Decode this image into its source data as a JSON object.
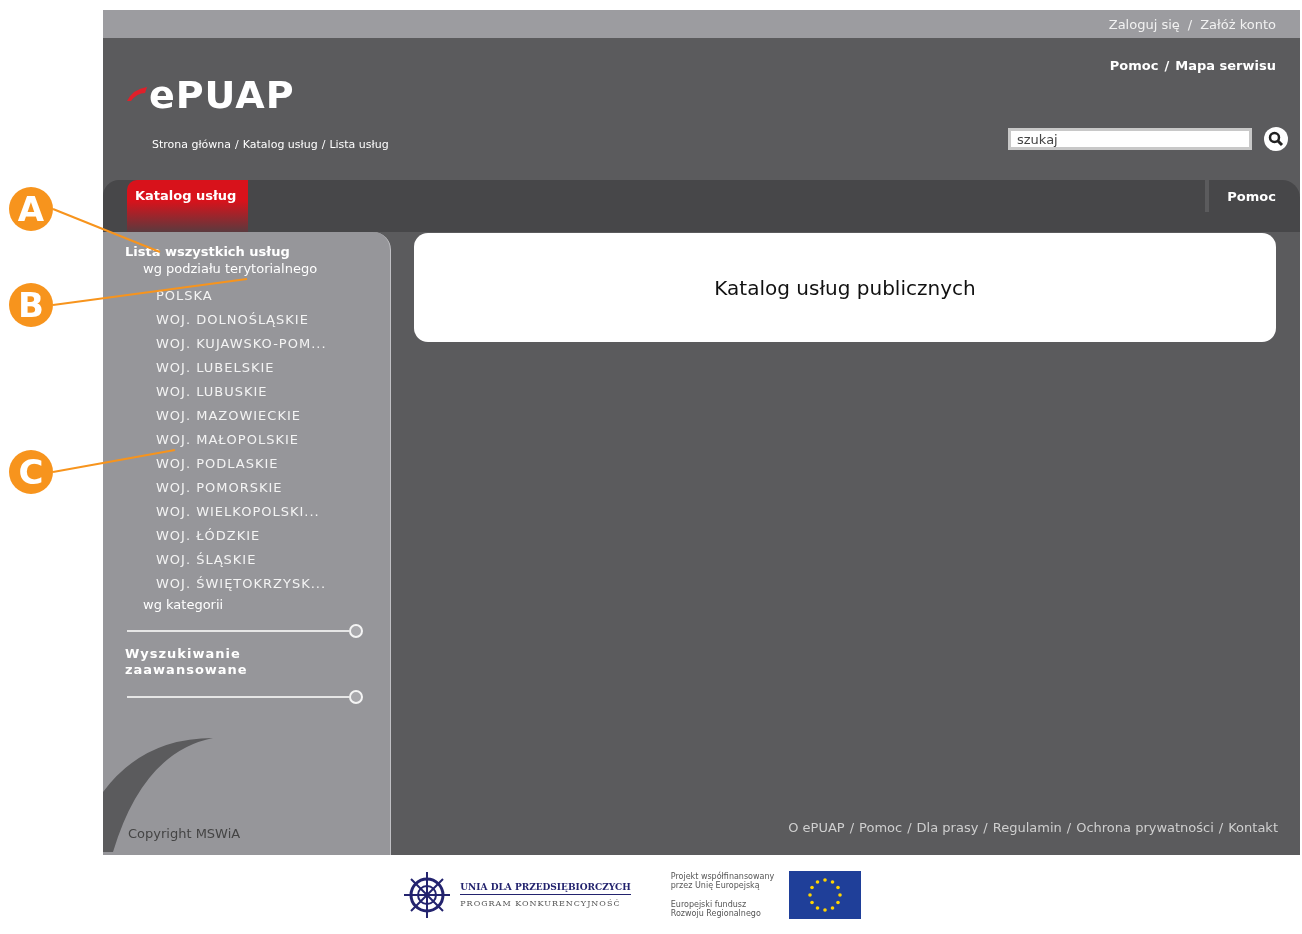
{
  "top_bar": {
    "links": [
      "Zaloguj się",
      "Załóż konto"
    ],
    "separator": "/"
  },
  "header": {
    "logo": "ePUAP",
    "links": [
      "Pomoc",
      "Mapa serwisu"
    ],
    "separator": "/",
    "breadcrumb": [
      "Strona główna",
      "Katalog usług",
      "Lista usług"
    ],
    "breadcrumb_separator": "/",
    "search": {
      "placeholder": "szukaj"
    }
  },
  "tabs": [
    {
      "label": "Katalog usług",
      "selected": true
    },
    {
      "label": "Pomoc",
      "selected": false
    }
  ],
  "sidebar": {
    "title": "Lista wszystkich usług",
    "groups": [
      {
        "label": "wg podziału terytorialnego",
        "children": [
          {
            "label": "POLSKA"
          },
          {
            "label": "WOJ. DOLNOŚLĄSKIE"
          },
          {
            "label": "WOJ. KUJAWSKO-POM..."
          },
          {
            "label": "WOJ. LUBELSKIE"
          },
          {
            "label": "WOJ. LUBUSKIE"
          },
          {
            "label": "WOJ. MAZOWIECKIE"
          },
          {
            "label": "WOJ. MAŁOPOLSKIE"
          },
          {
            "label": "WOJ. PODLASKIE"
          },
          {
            "label": "WOJ. POMORSKIE"
          },
          {
            "label": "WOJ. WIELKOPOLSKI..."
          },
          {
            "label": "WOJ. ŁÓDZKIE"
          },
          {
            "label": "WOJ. ŚLĄSKIE"
          },
          {
            "label": "WOJ. ŚWIĘTOKRZYSK..."
          }
        ]
      },
      {
        "label": "wg kategorii"
      }
    ],
    "advanced_search": "Wyszukiwanie zaawansowane",
    "copyright": "Copyright MSWiA"
  },
  "main": {
    "heading": "Katalog usług publicznych"
  },
  "footer": {
    "links": [
      "O ePUAP",
      "Pomoc",
      "Dla prasy",
      "Regulamin",
      "Ochrona prywatności",
      "Kontakt"
    ],
    "separator": "/",
    "sponsor_title": "UNIA DLA PRZEDSIĘBIORCZYCH",
    "sponsor_subtitle": "PROGRAM KONKURENCYJNOŚĆ",
    "eu_note_1": "Projekt współfinansowany przez Unię Europejską",
    "eu_note_2": "Europejski fundusz Rozwoju Regionalnego"
  },
  "callouts": [
    {
      "label": "A"
    },
    {
      "label": "B"
    },
    {
      "label": "C"
    }
  ]
}
